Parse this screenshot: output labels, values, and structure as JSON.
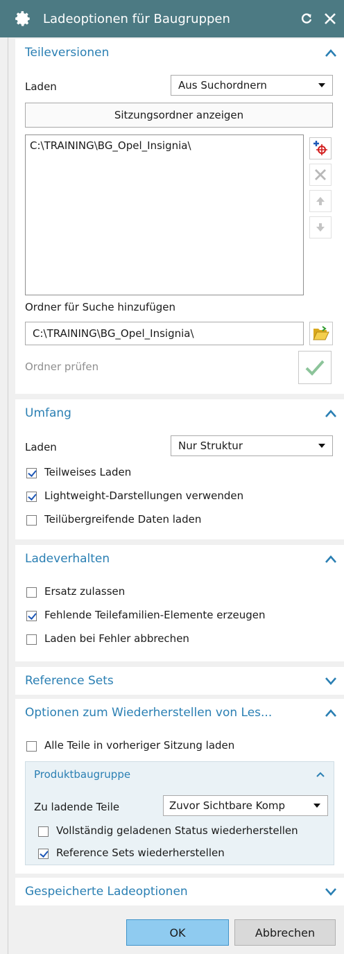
{
  "window": {
    "title": "Ladeoptionen für Baugruppen"
  },
  "teileversionen": {
    "header": "Teileversionen",
    "laden_label": "Laden",
    "laden_value": "Aus Suchordnern",
    "show_session_button": "Sitzungsordner anzeigen",
    "folder_list": [
      "C:\\TRAINING\\BG_Opel_Insignia\\"
    ],
    "add_folder_label": "Ordner für Suche hinzufügen",
    "add_folder_value": "C:\\TRAINING\\BG_Opel_Insignia\\",
    "check_folder_label": "Ordner prüfen"
  },
  "umfang": {
    "header": "Umfang",
    "laden_label": "Laden",
    "laden_value": "Nur Struktur",
    "checkboxes": [
      {
        "label": "Teilweises Laden",
        "checked": true
      },
      {
        "label": "Lightweight-Darstellungen verwenden",
        "checked": true
      },
      {
        "label": "Teilübergreifende Daten laden",
        "checked": false
      }
    ]
  },
  "ladeverhalten": {
    "header": "Ladeverhalten",
    "checkboxes": [
      {
        "label": "Ersatz zulassen",
        "checked": false
      },
      {
        "label": "Fehlende Teilefamilien-Elemente erzeugen",
        "checked": true
      },
      {
        "label": "Laden bei Fehler abbrechen",
        "checked": false
      }
    ]
  },
  "reference_sets": {
    "header": "Reference Sets"
  },
  "wiederherstellen": {
    "header": "Optionen zum Wiederherstellen von Les...",
    "all_parts": {
      "label": "Alle Teile in vorheriger Sitzung laden",
      "checked": false
    },
    "produktbaugruppe": {
      "header": "Produktbaugruppe",
      "parts_label": "Zu ladende Teile",
      "parts_value": "Zuvor Sichtbare Komp",
      "checkboxes": [
        {
          "label": "Vollständig geladenen Status wiederherstellen",
          "checked": false
        },
        {
          "label": "Reference Sets wiederherstellen",
          "checked": true
        }
      ]
    }
  },
  "gespeicherte": {
    "header": "Gespeicherte Ladeoptionen"
  },
  "footer": {
    "ok": "OK",
    "cancel": "Abbrechen"
  },
  "colors": {
    "titlebar": "#4c7a83",
    "accent": "#2a7fb3",
    "ok_button": "#8fcbf0",
    "subpanel": "#eaf2f6"
  }
}
